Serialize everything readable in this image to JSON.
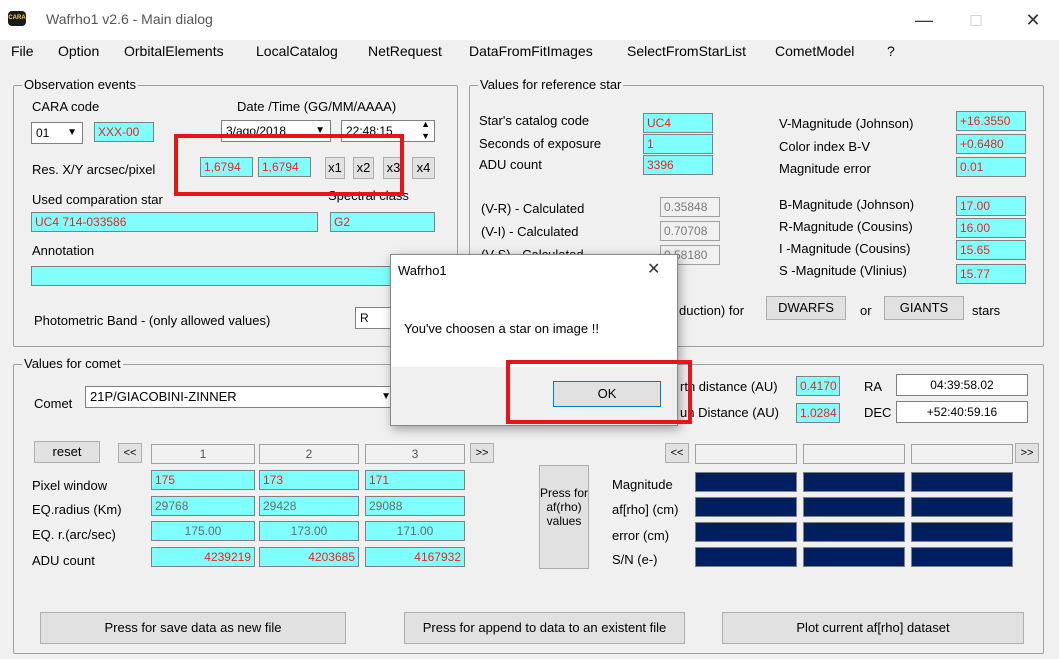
{
  "window": {
    "title": "Wafrho1 v2.6 - Main dialog",
    "icon_text": "CARA",
    "minimize": "—",
    "maximize": "□",
    "close": "✕"
  },
  "menu": [
    "File",
    "Option",
    "OrbitalElements",
    "LocalCatalog",
    "NetRequest",
    "DataFromFitImages",
    "SelectFromStarList",
    "CometModel",
    "?"
  ],
  "obs": {
    "group": "Observation events",
    "cara_label": "CARA code",
    "cara_value": "01",
    "cara_name": "XXX-00",
    "date_label": "Date /Time  (GG/MM/AAAA)",
    "date_value": "3/ago/2018",
    "time_value": "22:48:15",
    "res_label": "Res. X/Y arcsec/pixel",
    "res_x": "1,6794",
    "res_y": "1,6794",
    "x1": "x1",
    "x2": "x2",
    "x3": "x3",
    "x4": "x4",
    "comp_label": "Used comparation star",
    "comp_value": "UC4 714-033586",
    "spec_label": "Spectral class",
    "spec_value": "G2",
    "annot_label": "Annotation",
    "annot_value": "",
    "band_label": "Photometric Band  - (only allowed values)",
    "band_value": "R"
  },
  "ref": {
    "group": "Values for reference star",
    "code_label": "Star's catalog code",
    "code_value": "UC4",
    "exp_label": "Seconds of exposure",
    "exp_value": "1",
    "adu_label": "ADU count",
    "adu_value": "3396",
    "vr_label": "(V-R) - Calculated",
    "vr_value": "0.35848",
    "vi_label": "(V-I) - Calculated",
    "vi_value": "0.70708",
    "vs_label": "(V-S) - Calculated",
    "vs_value": "0.58180",
    "vmag_label": "V-Magnitude (Johnson)",
    "vmag_value": "+16.3550",
    "bv_label": "Color index B-V",
    "bv_value": "+0.6480",
    "err_label": "Magnitude error",
    "err_value": "0.01",
    "bmag_label": "B-Magnitude (Johnson)",
    "bmag_value": "17.00",
    "rmag_label": "R-Magnitude (Cousins)",
    "rmag_value": "16.00",
    "imag_label": "I -Magnitude (Cousins)",
    "imag_value": "15.65",
    "smag_label": "S -Magnitude (Vlinius)",
    "smag_value": "15.77",
    "reduction_label": "duction) for",
    "dwarfs": "DWARFS",
    "or": "or",
    "giants": "GIANTS",
    "stars": "stars"
  },
  "comet": {
    "group": "Values for comet",
    "comet_label": "Comet",
    "comet_value": "21P/GIACOBINI-ZINNER",
    "earth_label": "rth distance (AU)",
    "earth_value": "0.4170",
    "sun_label": "un Distance (AU)",
    "sun_value": "1.0284",
    "ra_label": "RA",
    "ra_value": "04:39:58.02",
    "dec_label": "DEC",
    "dec_value": "+52:40:59.16",
    "reset": "reset",
    "prev": "<<",
    "next": ">>",
    "cols": [
      "1",
      "2",
      "3"
    ],
    "rows": [
      {
        "label": "Pixel window",
        "values": [
          "175",
          "173",
          "171"
        ]
      },
      {
        "label": "EQ.radius (Km)",
        "values": [
          "29768",
          "29428",
          "29088"
        ]
      },
      {
        "label": "EQ. r.(arc/sec)",
        "values": [
          "175.00",
          "173.00",
          "171.00"
        ]
      },
      {
        "label": "ADU count",
        "values": [
          "4239219",
          "4203685",
          "4167932"
        ]
      }
    ],
    "press_btn": "Press for af(rho) values",
    "mag_label": "Magnitude",
    "afrho_label": "af[rho] (cm)",
    "error_label": "error (cm)",
    "sn_label": "S/N (e-)"
  },
  "footer": {
    "save": "Press for save data as new file",
    "append": "Press for append to  data to an existent file",
    "plot": "Plot current af[rho] dataset"
  },
  "dialog": {
    "title": "Wafrho1",
    "message": "You've choosen a star on image !!",
    "ok": "OK",
    "close": "✕"
  },
  "colors": {
    "cyan_field": "#80ffff",
    "highlight": "#e8141c",
    "navy_cell": "#001f5f"
  }
}
